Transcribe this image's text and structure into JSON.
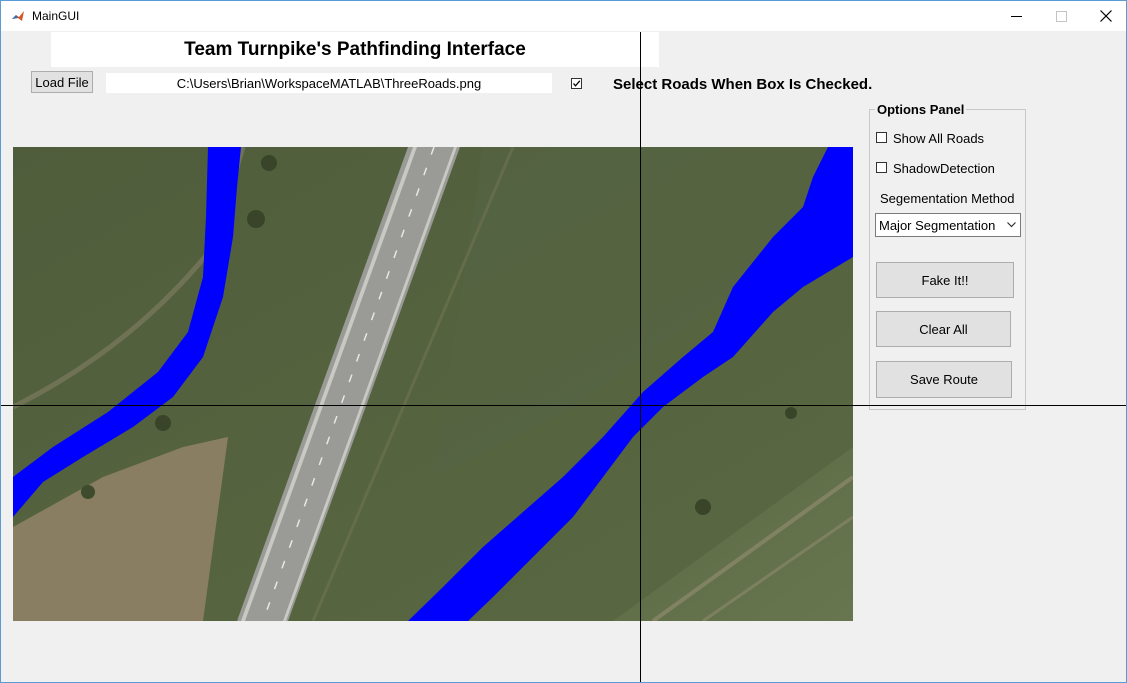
{
  "window": {
    "title": "MainGUI",
    "app_icon": "matlab-icon",
    "controls": [
      "minimize-icon",
      "maximize-icon",
      "close-icon"
    ]
  },
  "header": {
    "title": "Team Turnpike's Pathfinding Interface"
  },
  "toolbar": {
    "load_label": "Load File",
    "file_path": "C:\\Users\\Brian\\WorkspaceMATLAB\\ThreeRoads.png",
    "select_checked": true,
    "select_hint": "Select Roads When Box Is Checked."
  },
  "options": {
    "title": "Options Panel",
    "show_all_roads": "Show All Roads",
    "show_all_roads_checked": false,
    "shadow_detection": "ShadowDetection",
    "shadow_detection_checked": false,
    "segmentation_label": "Segementation Method",
    "segmentation_value": "Major Segmentation",
    "fake_it_label": "Fake It!!",
    "clear_all_label": "Clear All",
    "save_route_label": "Save Route"
  },
  "colors": {
    "segmentation_overlay": "#0000ff",
    "crosshair": "#000000"
  }
}
